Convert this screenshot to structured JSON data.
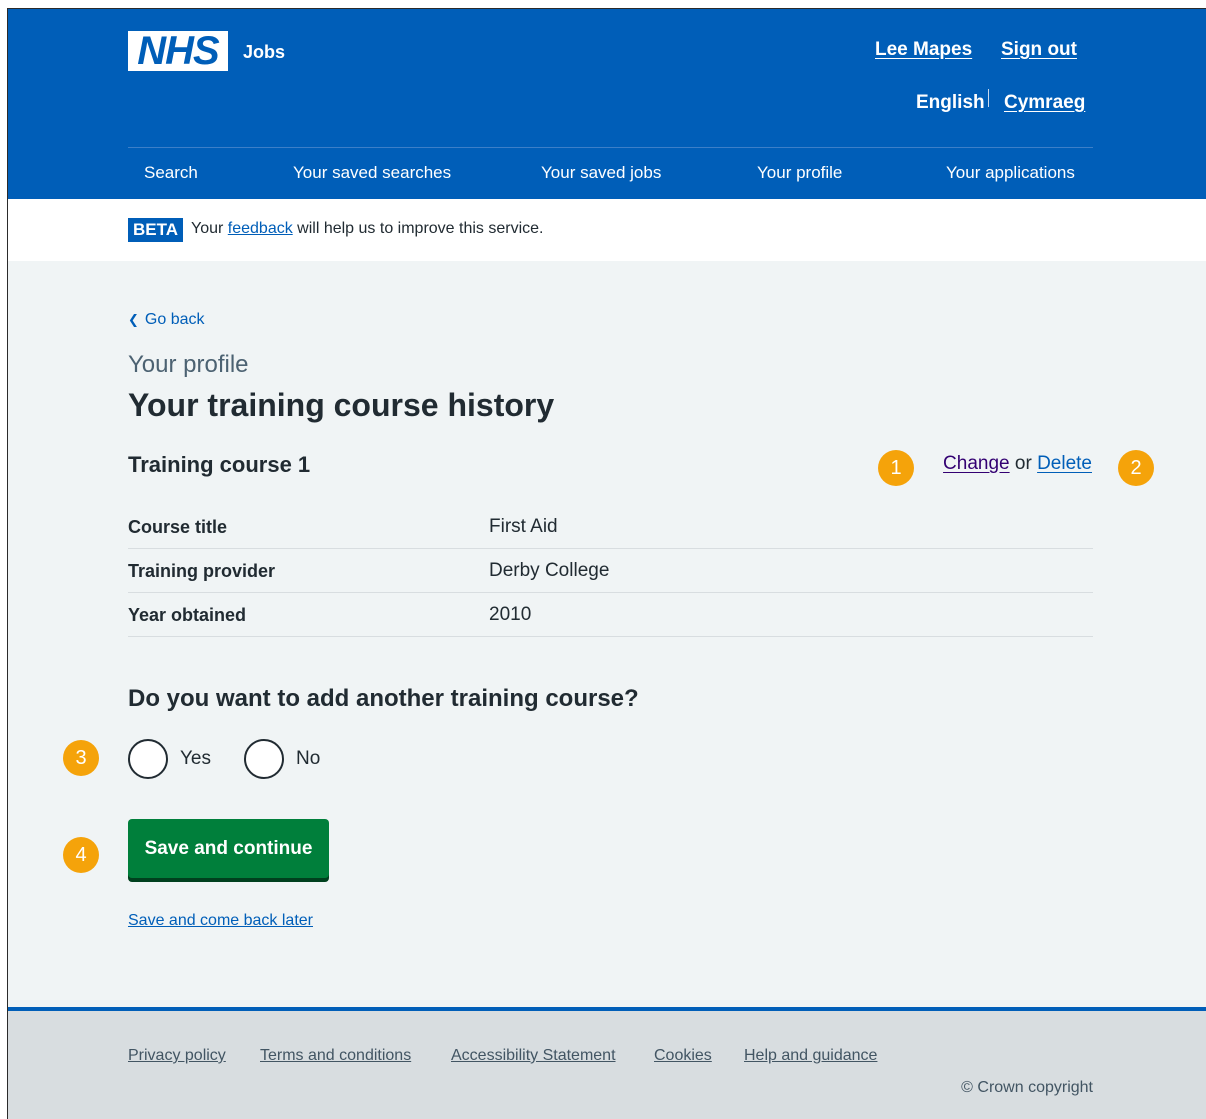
{
  "header": {
    "logo_text": "NHS",
    "service_name": "Jobs",
    "user_name": "Lee Mapes",
    "sign_out": "Sign out",
    "lang_english": "English",
    "lang_welsh": "Cymraeg",
    "nav": [
      "Search",
      "Your saved searches",
      "Your saved jobs",
      "Your profile",
      "Your applications"
    ]
  },
  "beta": {
    "tag": "BETA",
    "text_before": "Your ",
    "link": "feedback",
    "text_after": " will help us to improve this service."
  },
  "main": {
    "back_link": "Go back",
    "caption": "Your profile",
    "title": "Your training course history",
    "course_heading": "Training course 1",
    "change_link": "Change",
    "or_text": "or",
    "delete_link": "Delete",
    "rows": [
      {
        "key": "Course title",
        "value": "First Aid"
      },
      {
        "key": "Training provider",
        "value": "Derby College"
      },
      {
        "key": "Year obtained",
        "value": "2010"
      }
    ],
    "question": "Do you want to add another training course?",
    "radio_yes": "Yes",
    "radio_no": "No",
    "submit": "Save and continue",
    "save_later": "Save and come back later"
  },
  "markers": [
    "1",
    "2",
    "3",
    "4"
  ],
  "footer": {
    "links": [
      "Privacy policy",
      "Terms and conditions",
      "Accessibility Statement",
      "Cookies",
      "Help and guidance"
    ],
    "copyright": "© Crown copyright"
  },
  "colors": {
    "nhs_blue": "#005eb8",
    "button_green": "#007f3b",
    "marker_orange": "#f5a30a",
    "page_background": "#f0f4f5"
  }
}
